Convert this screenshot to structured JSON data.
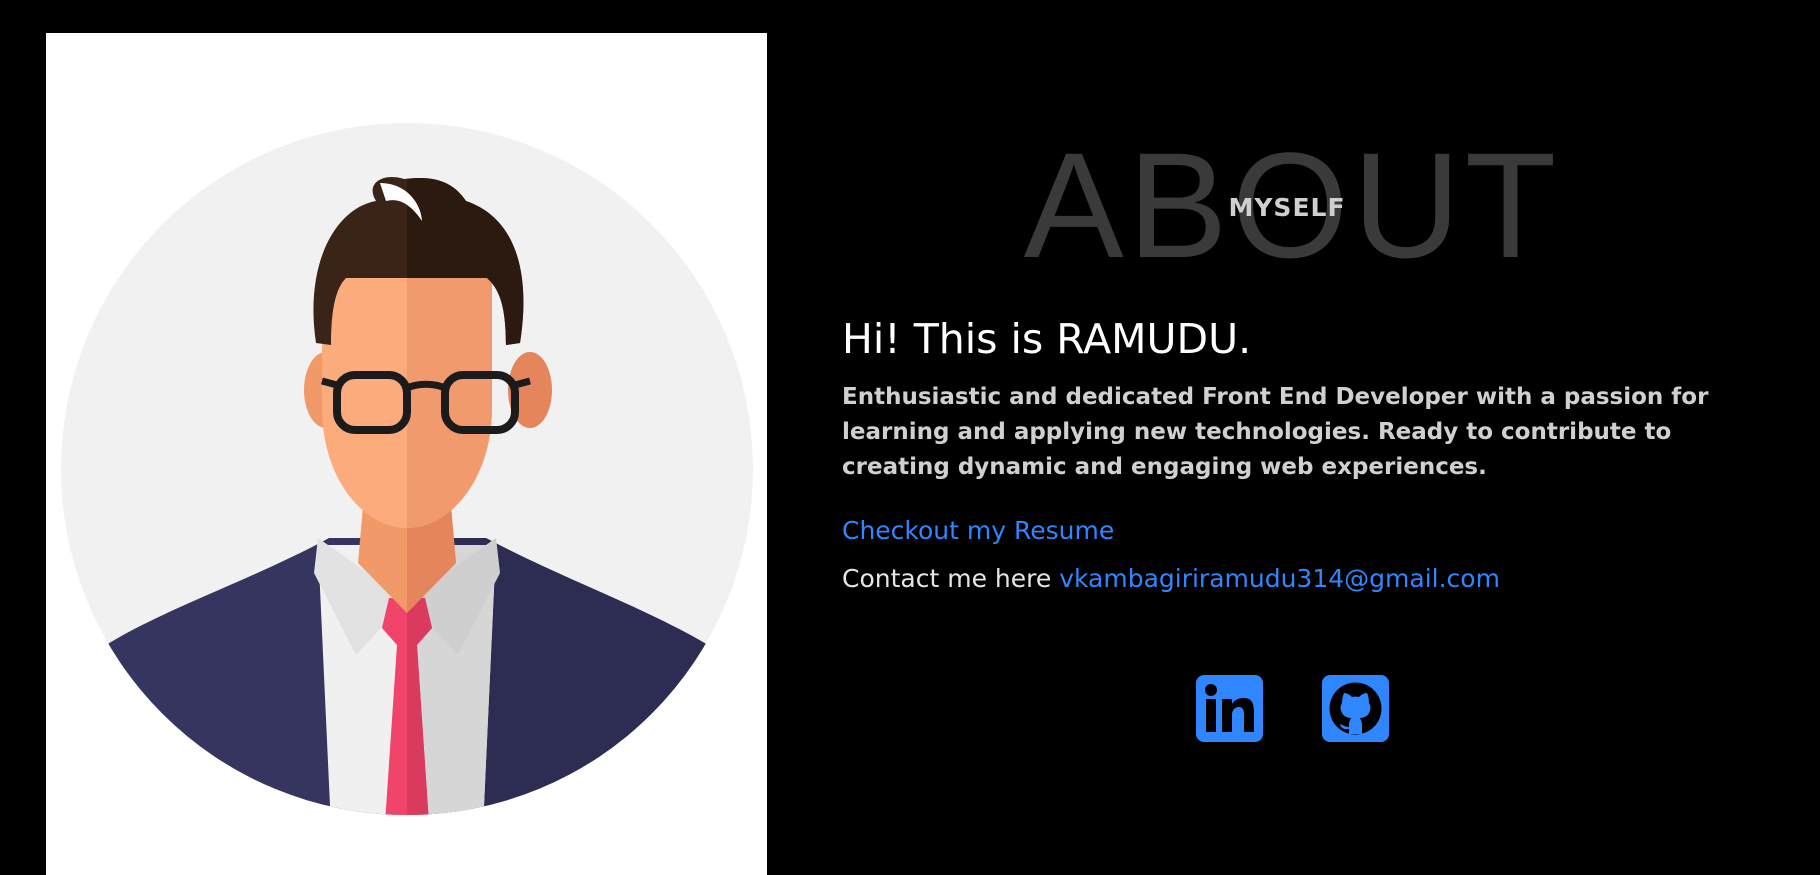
{
  "about": {
    "title_big": "ABOUT",
    "title_small": "MYSELF",
    "greeting": "Hi! This is RAMUDU.",
    "intro": "Enthusiastic and dedicated Front End Developer with a passion for learning and applying new technologies. Ready to contribute to creating dynamic and engaging web experiences.",
    "resume_link": "Checkout my Resume",
    "contact_label": "Contact me here",
    "contact_email": "vkambagiriramudu314@gmail.com"
  },
  "socials": [
    {
      "icon": "linkedin-icon"
    },
    {
      "icon": "github-icon"
    }
  ],
  "colors": {
    "background": "#000000",
    "accent": "#2f86ff",
    "heading_watermark": "#3a3a3a"
  }
}
